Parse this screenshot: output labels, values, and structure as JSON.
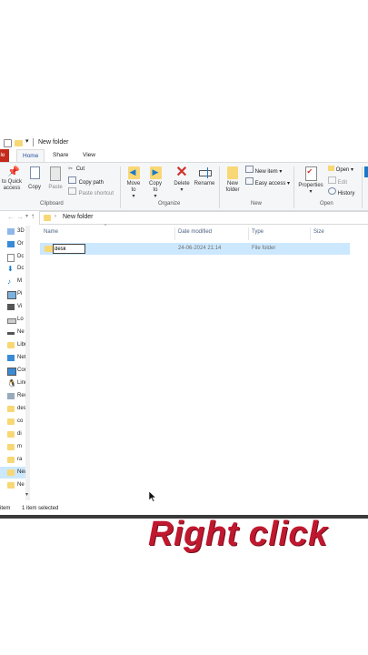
{
  "window": {
    "title": "New folder",
    "file_tab": "ile",
    "tabs": [
      "Home",
      "Share",
      "View"
    ]
  },
  "ribbon": {
    "clipboard": {
      "pin_label": "to Quick access",
      "copy_label": "Copy",
      "paste_label": "Paste",
      "cut_label": "Cut",
      "copy_path_label": "Copy path",
      "paste_shortcut_label": "Paste shortcut",
      "group_label": "Clipboard"
    },
    "organize": {
      "move_to_label": "Move to",
      "copy_to_label": "Copy to",
      "delete_label": "Delete",
      "rename_label": "Rename",
      "group_label": "Organize"
    },
    "new": {
      "new_folder_label": "New folder",
      "new_item_label": "New item",
      "easy_access_label": "Easy access",
      "group_label": "New"
    },
    "open": {
      "properties_label": "Properties",
      "open_label": "Open",
      "edit_label": "Edit",
      "history_label": "History",
      "group_label": "Open"
    }
  },
  "address": {
    "path": "New folder"
  },
  "columns": {
    "name": "Name",
    "date": "Date modified",
    "type": "Type",
    "size": "Size"
  },
  "file_row": {
    "name_edit_value": "desk",
    "date": "24-06-2024 21:14",
    "type": "File folder"
  },
  "nav_items": [
    "3D",
    "Or",
    "Dc",
    "Dc",
    "M",
    "Pi",
    "Vi",
    "Lo",
    "Ne",
    "Libr",
    "Net",
    "Cor",
    "Linu",
    "Rec",
    "desl",
    "co",
    "di",
    "m",
    "ra",
    "New",
    "Ne"
  ],
  "status": {
    "items_count": "item",
    "selected": "1 item selected"
  },
  "caption": "Right click",
  "colors": {
    "accent": "#1979ca",
    "file_tab": "#c42b1c",
    "selection": "#cce8ff",
    "caption": "#c0182f"
  }
}
